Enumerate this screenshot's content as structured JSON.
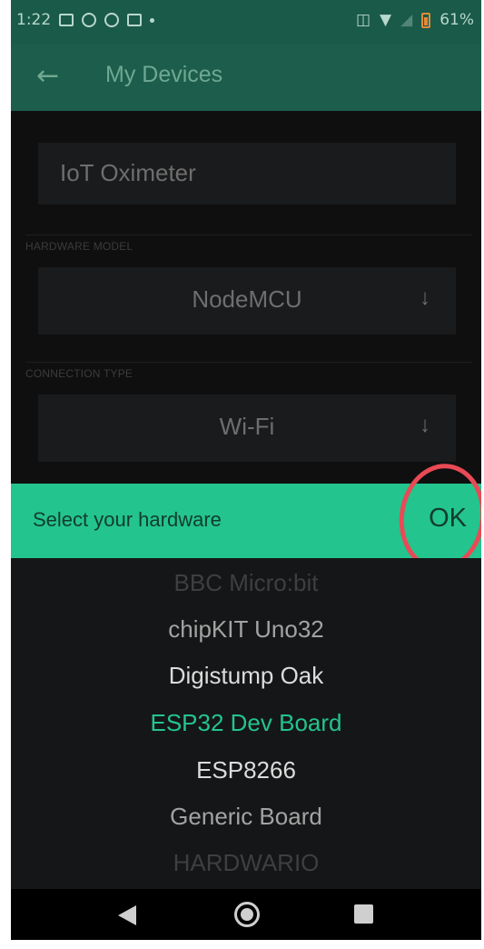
{
  "status_bar": {
    "time": "1:22",
    "battery": "61%",
    "icons": [
      "gallery-icon",
      "notification-icon",
      "notification-icon",
      "instagram-icon",
      "vibrate-icon",
      "wifi-icon",
      "signal-icon",
      "battery-charging-icon"
    ]
  },
  "app_bar": {
    "title": "My Devices",
    "back_icon": "arrow-left-icon"
  },
  "form": {
    "device_name": "IoT Oximeter",
    "hardware_model_label": "HARDWARE MODEL",
    "hardware_model": "NodeMCU",
    "connection_type_label": "CONNECTION TYPE",
    "connection_type": "Wi-Fi"
  },
  "picker": {
    "prompt": "Select your hardware",
    "ok_label": "OK",
    "items": [
      {
        "label": "BBC Micro:bit",
        "state": "faded-top"
      },
      {
        "label": "chipKIT Uno32",
        "state": "dim"
      },
      {
        "label": "Digistump Oak",
        "state": "near"
      },
      {
        "label": "ESP32 Dev Board",
        "state": "selected"
      },
      {
        "label": "ESP8266",
        "state": "near"
      },
      {
        "label": "Generic Board",
        "state": "dim"
      },
      {
        "label": "HARDWARIO",
        "state": "faded-bottom"
      }
    ]
  },
  "colors": {
    "accent": "#23c48e",
    "app_bar": "#1c5e4b",
    "highlight_circle": "#e94a55"
  }
}
